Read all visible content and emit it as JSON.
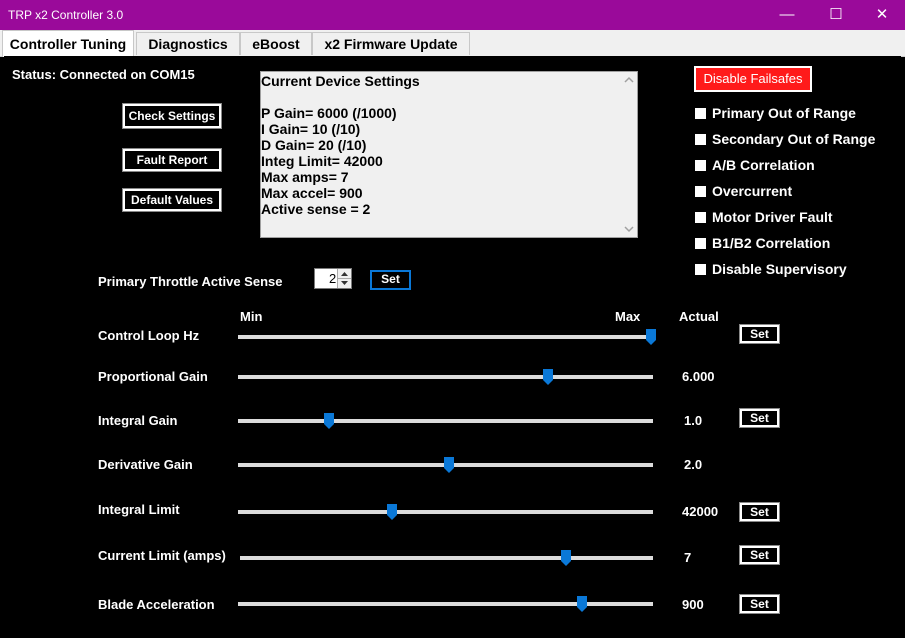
{
  "window": {
    "title": "TRP x2  Controller 3.0",
    "min_glyph": "—",
    "max_glyph": "☐",
    "close_glyph": "✕"
  },
  "tabs": [
    {
      "label": "Controller Tuning"
    },
    {
      "label": "Diagnostics"
    },
    {
      "label": "eBoost"
    },
    {
      "label": "x2 Firmware Update"
    }
  ],
  "status": "Status: Connected on COM15",
  "buttons": {
    "check_settings": "Check Settings",
    "fault_report": "Fault Report",
    "default_values": "Default Values",
    "set": "Set",
    "disable_failsafes": "Disable Failsafes"
  },
  "settings_box": {
    "lines": [
      "Current Device Settings",
      "",
      "P Gain= 6000 (/1000)",
      "I Gain= 10 (/10)",
      "D Gain= 20 (/10)",
      "Integ Limit= 42000",
      "Max amps= 7",
      "Max accel= 900",
      "Active sense = 2"
    ]
  },
  "failsafes": [
    {
      "label": "Primary Out of Range",
      "checked": false
    },
    {
      "label": "Secondary Out of Range",
      "checked": false
    },
    {
      "label": "A/B Correlation",
      "checked": false
    },
    {
      "label": "Overcurrent",
      "checked": false
    },
    {
      "label": "Motor Driver Fault",
      "checked": false
    },
    {
      "label": "B1/B2 Correlation",
      "checked": false
    },
    {
      "label": "Disable Supervisory",
      "checked": false
    }
  ],
  "active_sense": {
    "label": "Primary Throttle Active Sense",
    "value": "2"
  },
  "slider_header": {
    "min": "Min",
    "max": "Max",
    "actual": "Actual"
  },
  "sliders": [
    {
      "label": "Control Loop Hz",
      "position": 1.0,
      "actual": "",
      "has_set": true
    },
    {
      "label": "Proportional Gain",
      "position": 0.745,
      "actual": "6.000",
      "has_set": false
    },
    {
      "label": "Integral Gain",
      "position": 0.205,
      "actual": "1.0",
      "has_set": true
    },
    {
      "label": "Derivative Gain",
      "position": 0.5,
      "actual": "2.0",
      "has_set": false
    },
    {
      "label": "Integral Limit",
      "position": 0.36,
      "actual": "42000",
      "has_set": true
    },
    {
      "label": "Current Limit (amps)",
      "position": 0.79,
      "actual": "7",
      "has_set": true
    },
    {
      "label": "Blade Acceleration",
      "position": 0.83,
      "actual": "900",
      "has_set": true
    }
  ],
  "colors": {
    "titlebar": "#9a0a9a",
    "panel": "#000000",
    "failsafe_button": "#ff1a1a",
    "slider_thumb": "#0a78d7"
  }
}
